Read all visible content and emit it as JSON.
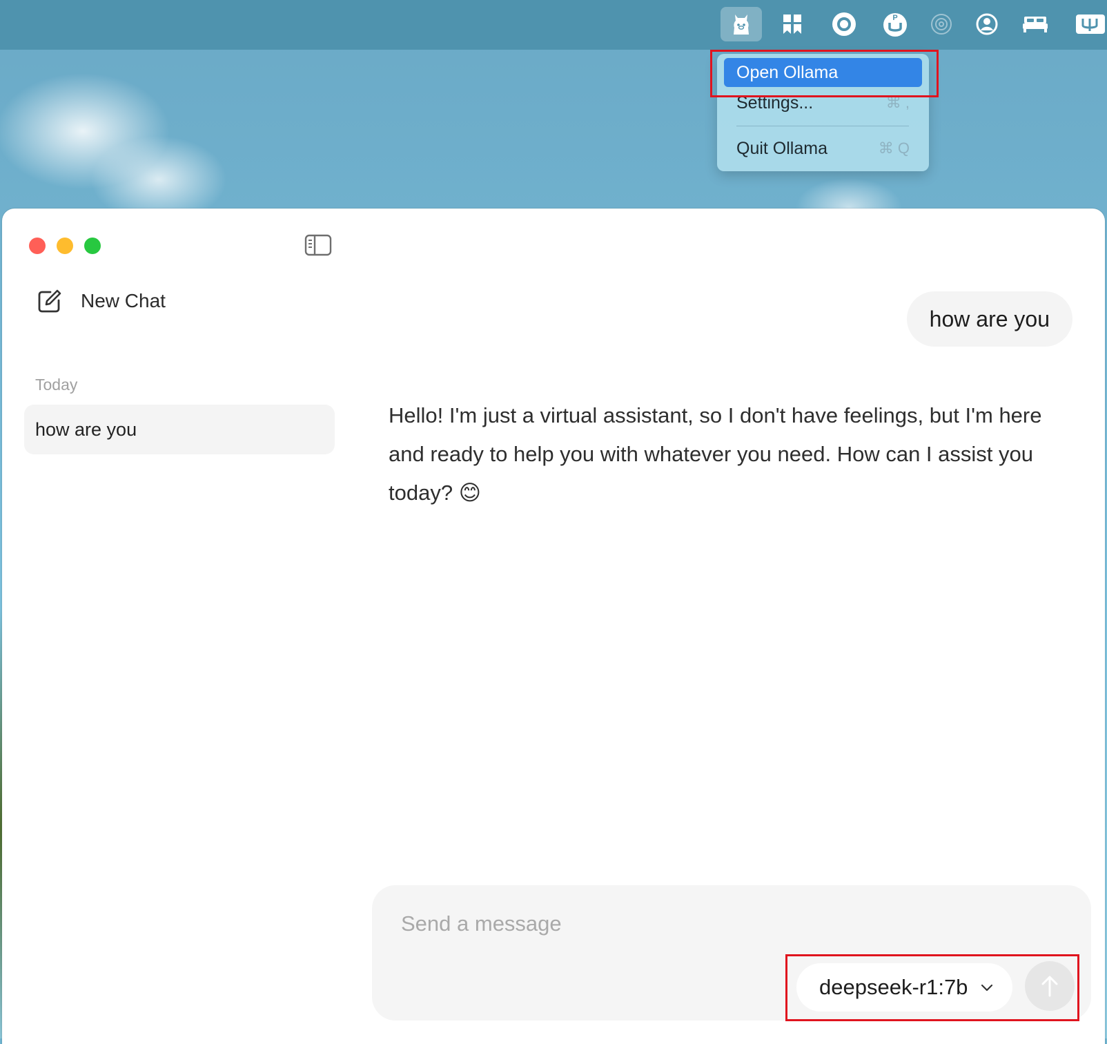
{
  "menubar": {
    "icons": [
      {
        "name": "ollama-llama-icon",
        "active": true
      },
      {
        "name": "bookmark-grid-icon",
        "active": false
      },
      {
        "name": "record-circle-icon",
        "active": false
      },
      {
        "name": "p-shield-icon",
        "active": false
      },
      {
        "name": "airdrop-icon",
        "active": false
      },
      {
        "name": "user-account-icon",
        "active": false
      },
      {
        "name": "bed-icon",
        "active": false
      },
      {
        "name": "keyboard-input-icon",
        "active": false
      }
    ]
  },
  "dropdown": {
    "items": [
      {
        "label": "Open Ollama",
        "shortcut": ""
      },
      {
        "label": "Settings...",
        "shortcut": "⌘ ,"
      },
      {
        "label": "Quit Ollama",
        "shortcut": "⌘ Q"
      }
    ]
  },
  "sidebar": {
    "new_chat_label": "New Chat",
    "section_label": "Today",
    "chats": [
      {
        "label": "how are you"
      }
    ]
  },
  "conversation": {
    "user_message": "how are you",
    "assistant_message": "Hello! I'm just a virtual assistant, so I don't have feelings, but I'm here and ready to help you with whatever you need. How can I assist you today? 😊"
  },
  "composer": {
    "placeholder": "Send a message",
    "model": "deepseek-r1:7b"
  },
  "colors": {
    "menu_highlight": "#3385e6",
    "annotation_red": "#e0141e",
    "close": "#ff5f57",
    "minimize": "#febc2e",
    "zoom": "#28c840"
  }
}
